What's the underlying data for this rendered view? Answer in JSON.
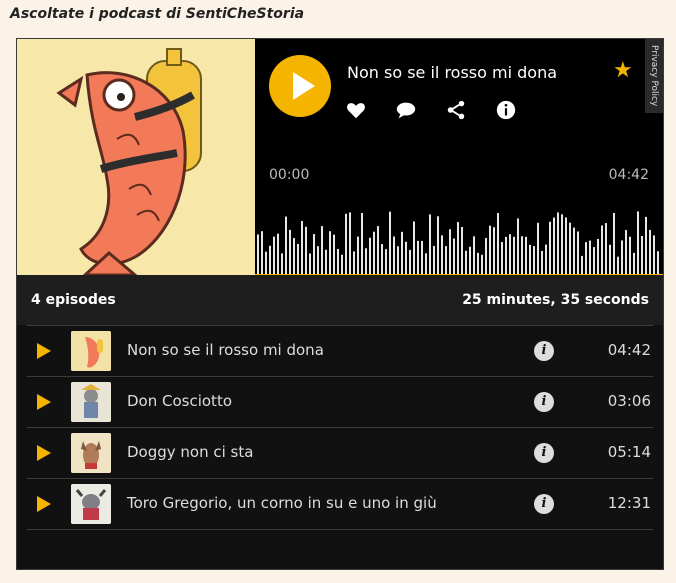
{
  "page": {
    "heading": "Ascoltate i podcast di SentiCheStoria"
  },
  "player": {
    "current_title": "Non so se il rosso mi dona",
    "time_start": "00:00",
    "time_end": "04:42",
    "privacy_label": "Privacy Policy",
    "accent_color": "#f4b400",
    "actions": [
      "heart-icon",
      "comment-icon",
      "share-icon",
      "info-icon"
    ]
  },
  "summary": {
    "episodes": "4 episodes",
    "total_duration": "25 minutes, 35 seconds"
  },
  "episodes": [
    {
      "title": "Non so se il rosso mi dona",
      "duration": "04:42"
    },
    {
      "title": "Don Cosciotto",
      "duration": "03:06"
    },
    {
      "title": "Doggy non ci sta",
      "duration": "05:14"
    },
    {
      "title": "Toro Gregorio, un corno in su e uno in giù",
      "duration": "12:31"
    }
  ]
}
